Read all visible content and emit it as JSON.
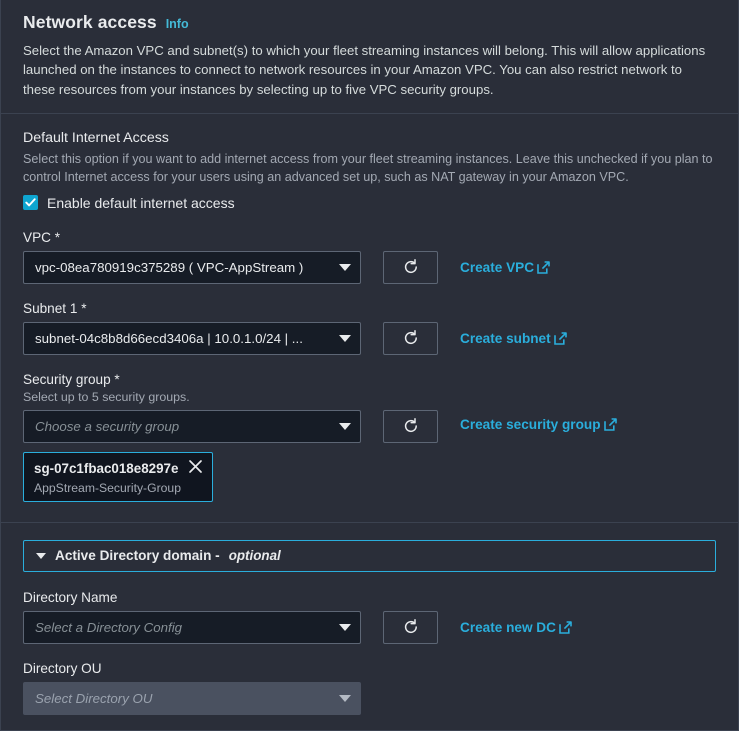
{
  "header": {
    "title": "Network access",
    "info_label": "Info",
    "description": "Select the Amazon VPC and subnet(s) to which your fleet streaming instances will belong. This will allow applications launched on the instances to connect to network resources in your Amazon VPC. You can also restrict network to these resources from your instances by selecting up to five VPC security groups."
  },
  "internet_access": {
    "section_title": "Default Internet Access",
    "section_desc": "Select this option if you want to add internet access from your fleet streaming instances. Leave this unchecked if you plan to control Internet access for your users using an advanced set up, such as NAT gateway in your Amazon VPC.",
    "checkbox_label": "Enable default internet access",
    "checked": true
  },
  "vpc": {
    "label": "VPC *",
    "value": "vpc-08ea780919c375289 ( VPC-AppStream )",
    "create_link": "Create VPC",
    "refresh_icon": "refresh-icon",
    "external_icon": "external-link-icon"
  },
  "subnet": {
    "label": "Subnet 1 *",
    "value": "subnet-04c8b8d66ecd3406a | 10.0.1.0/24 | ...",
    "create_link": "Create subnet"
  },
  "security_group": {
    "label": "Security group *",
    "hint": "Select up to 5 security groups.",
    "placeholder": "Choose a security group",
    "create_link": "Create security group",
    "tokens": [
      {
        "id": "sg-07c1fbac018e8297e",
        "name": "AppStream-Security-Group",
        "dismiss_icon": "close-icon"
      }
    ]
  },
  "active_directory": {
    "expander_label": "Active Directory domain -",
    "expander_optional": "optional",
    "expanded": true,
    "directory_name": {
      "label": "Directory Name",
      "placeholder": "Select a Directory Config",
      "create_link": "Create new DC"
    },
    "directory_ou": {
      "label": "Directory OU",
      "placeholder": "Select Directory OU",
      "disabled": true
    }
  },
  "colors": {
    "panel_bg": "#2a2e39",
    "input_bg": "#161c26",
    "accent": "#2aaedc",
    "checkbox": "#0ea5d0",
    "border": "#3b4250",
    "text": "#e9ebed",
    "muted": "#a3a9b3"
  }
}
